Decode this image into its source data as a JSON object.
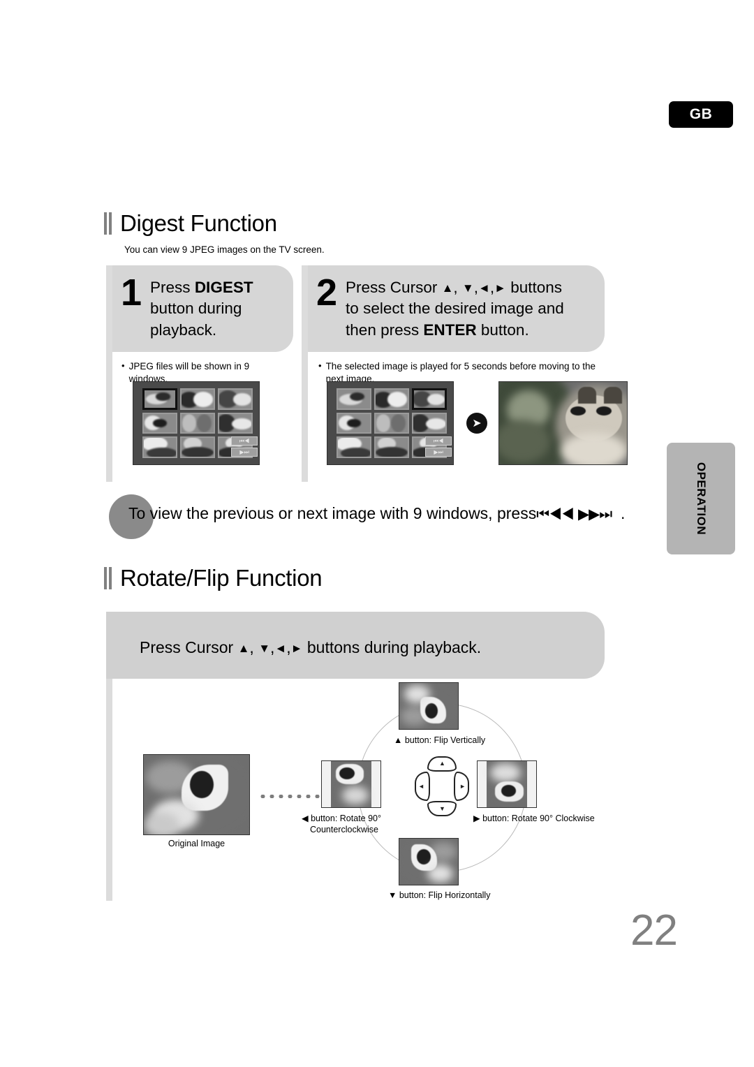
{
  "page": {
    "language_badge": "GB",
    "number": "22",
    "side_tab": "OPERATION"
  },
  "digest": {
    "heading": "Digest Function",
    "intro": "You can view 9 JPEG images on the TV screen.",
    "steps": [
      {
        "number": "1",
        "line1_pre": "Press ",
        "line1_bold": "DIGEST",
        "line2": "button during",
        "line3": "playback.",
        "bullet_dot": "•",
        "bullet": "JPEG files will be shown in 9 windows."
      },
      {
        "number": "2",
        "line1_pre": "Press Cursor ",
        "cursor_up": "▲",
        "cursor_down": "▼",
        "cursor_left": "◄",
        "cursor_right": "►",
        "line1_post": " buttons",
        "line2": "to select the desired image and",
        "line3_pre": "then press ",
        "line3_bold": "ENTER",
        "line3_post": " button.",
        "bullet_dot": "•",
        "bullet": "The selected image is played for 5 seconds before moving to the next image."
      }
    ],
    "tip": {
      "text_pre": "To view the previous or next image with 9 windows, press",
      "icon_prev": "⏮◀◀",
      "icon_next": "▶▶⏭",
      "text_post": "."
    },
    "tv_buttons": {
      "prev": "⏮◀",
      "next": "▶⏭"
    }
  },
  "rotate_flip": {
    "heading": "Rotate/Flip Function",
    "banner_pre": "Press Cursor ",
    "cursor_up": "▲",
    "cursor_down": "▼",
    "cursor_left": "◄",
    "cursor_right": "►",
    "banner_post": " buttons during playback.",
    "original_caption": "Original Image",
    "labels": {
      "up": "▲ button: Flip Vertically",
      "right": "▶ button: Rotate 90° Clockwise",
      "left_line1": "◀ button: Rotate 90°",
      "left_line2": "Counterclockwise",
      "down": "▼ button: Flip Horizontally"
    },
    "pad_glyphs": {
      "up": "▲",
      "down": "▼",
      "left": "◄",
      "right": "►"
    }
  },
  "colors": {
    "badge_bg": "#000000",
    "step_box": "#d6d6d6",
    "tab_bg": "#b4b4b4",
    "tip_circle": "#8a8a8a",
    "page_num": "#808080"
  }
}
